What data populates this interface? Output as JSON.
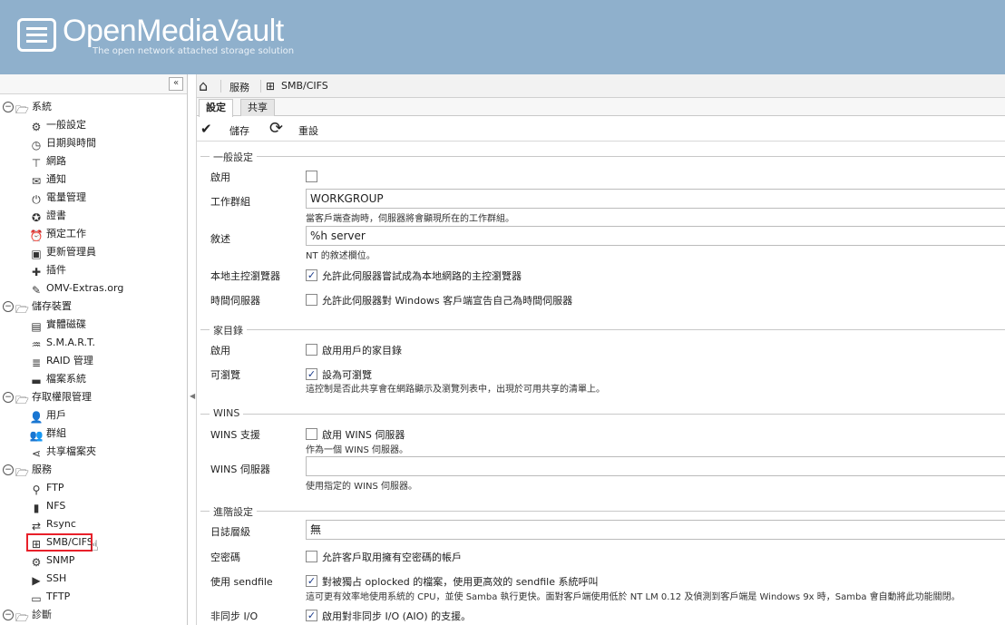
{
  "header": {
    "title": "OpenMediaVault",
    "subtitle": "The open network attached storage solution"
  },
  "sidebar": {
    "collapse": "«",
    "tree": [
      {
        "type": "cat",
        "icon": "folder-open-icon",
        "glyph": "🗁",
        "label": "系統"
      },
      {
        "type": "leaf",
        "icon": "gears-icon",
        "glyph": "⚙",
        "label": "一般設定"
      },
      {
        "type": "leaf",
        "icon": "clock-icon",
        "glyph": "◷",
        "label": "日期與時間"
      },
      {
        "type": "leaf",
        "icon": "network-icon",
        "glyph": "⊤",
        "label": "網路"
      },
      {
        "type": "leaf",
        "icon": "envelope-icon",
        "glyph": "✉",
        "label": "通知"
      },
      {
        "type": "leaf",
        "icon": "power-icon",
        "glyph": "⏻",
        "label": "電量管理"
      },
      {
        "type": "leaf",
        "icon": "certificate-icon",
        "glyph": "✪",
        "label": "證書"
      },
      {
        "type": "leaf",
        "icon": "alarm-icon",
        "glyph": "⏰",
        "label": "預定工作"
      },
      {
        "type": "leaf",
        "icon": "update-icon",
        "glyph": "▣",
        "label": "更新管理員"
      },
      {
        "type": "leaf",
        "icon": "puzzle-icon",
        "glyph": "✚",
        "label": "插件"
      },
      {
        "type": "leaf",
        "icon": "wrench-icon",
        "glyph": "✎",
        "label": "OMV-Extras.org"
      },
      {
        "type": "cat",
        "icon": "folder-open-icon",
        "glyph": "🗁",
        "label": "儲存裝置"
      },
      {
        "type": "leaf",
        "icon": "disk-icon",
        "glyph": "▤",
        "label": "實體磁碟"
      },
      {
        "type": "leaf",
        "icon": "smart-icon",
        "glyph": "♒",
        "label": "S.M.A.R.T."
      },
      {
        "type": "leaf",
        "icon": "raid-icon",
        "glyph": "≣",
        "label": "RAID 管理"
      },
      {
        "type": "leaf",
        "icon": "folder-icon",
        "glyph": "▬",
        "label": "檔案系統"
      },
      {
        "type": "cat",
        "icon": "folder-open-icon",
        "glyph": "🗁",
        "label": "存取權限管理"
      },
      {
        "type": "leaf",
        "icon": "user-icon",
        "glyph": "👤",
        "label": "用戶"
      },
      {
        "type": "leaf",
        "icon": "group-icon",
        "glyph": "👥",
        "label": "群組"
      },
      {
        "type": "leaf",
        "icon": "share-icon",
        "glyph": "⋖",
        "label": "共享檔案夾"
      },
      {
        "type": "cat",
        "icon": "folder-open-icon",
        "glyph": "🗁",
        "label": "服務"
      },
      {
        "type": "leaf",
        "icon": "ftp-icon",
        "glyph": "⚲",
        "label": "FTP"
      },
      {
        "type": "leaf",
        "icon": "file-icon",
        "glyph": "▮",
        "label": "NFS"
      },
      {
        "type": "leaf",
        "icon": "rsync-icon",
        "glyph": "⇄",
        "label": "Rsync"
      },
      {
        "type": "leaf",
        "icon": "windows-icon",
        "glyph": "⊞",
        "label": "SMB/CIFS",
        "selected": true
      },
      {
        "type": "leaf",
        "icon": "snmp-icon",
        "glyph": "⚙",
        "label": "SNMP"
      },
      {
        "type": "leaf",
        "icon": "terminal-icon",
        "glyph": "▶",
        "label": "SSH"
      },
      {
        "type": "leaf",
        "icon": "tftp-icon",
        "glyph": "▭",
        "label": "TFTP"
      },
      {
        "type": "cat",
        "icon": "folder-open-icon",
        "glyph": "🗁",
        "label": "診斷"
      }
    ]
  },
  "breadcrumb": {
    "services": "服務",
    "smb": "SMB/CIFS"
  },
  "tabs": {
    "settings": "設定",
    "shares": "共享"
  },
  "toolbar": {
    "save": "儲存",
    "reset": "重設"
  },
  "general": {
    "legend": "一般設定",
    "enable_label": "啟用",
    "workgroup_label": "工作群組",
    "workgroup_value": "WORKGROUP",
    "workgroup_hint": "當客戶端查詢時，伺服器將會顯現所在的工作群組。",
    "desc_label": "敘述",
    "desc_value": "%h server",
    "desc_hint": "NT 的敘述欄位。",
    "master_label": "本地主控瀏覽器",
    "master_text": "允許此伺服器嘗試成為本地網路的主控瀏覽器",
    "time_label": "時間伺服器",
    "time_text": "允許此伺服器對 Windows 客戶端宣告自己為時間伺服器"
  },
  "homes": {
    "legend": "家目錄",
    "enable_label": "啟用",
    "enable_text": "啟用用戶的家目錄",
    "browse_label": "可瀏覽",
    "browse_text": "設為可瀏覽",
    "browse_hint": "這控制是否此共享會在網路顯示及瀏覽列表中，出現於可用共享的清單上。"
  },
  "wins": {
    "legend": "WINS",
    "support_label": "WINS 支援",
    "support_text": "啟用 WINS 伺服器",
    "support_hint": "作為一個 WINS 伺服器。",
    "server_label": "WINS 伺服器",
    "server_value": "",
    "server_hint": "使用指定的 WINS 伺服器。"
  },
  "advanced": {
    "legend": "進階設定",
    "log_label": "日誌層級",
    "log_value": "無",
    "null_label": "空密碼",
    "null_text": "允許客戶取用擁有空密碼的帳戶",
    "sendfile_label": "使用 sendfile",
    "sendfile_text": "對被獨占 oplocked 的檔案，使用更高效的 sendfile 系統呼叫",
    "sendfile_hint": "這可更有效率地使用系統的 CPU，並使 Samba 執行更快。面對客戶端使用低於 NT LM 0.12 及偵測到客戶端是 Windows 9x 時，Samba 會自動將此功能關閉。",
    "aio_label": "非同步 I/O",
    "aio_text": "啟用對非同步 I/O (AIO) 的支援。"
  },
  "check": "✓"
}
